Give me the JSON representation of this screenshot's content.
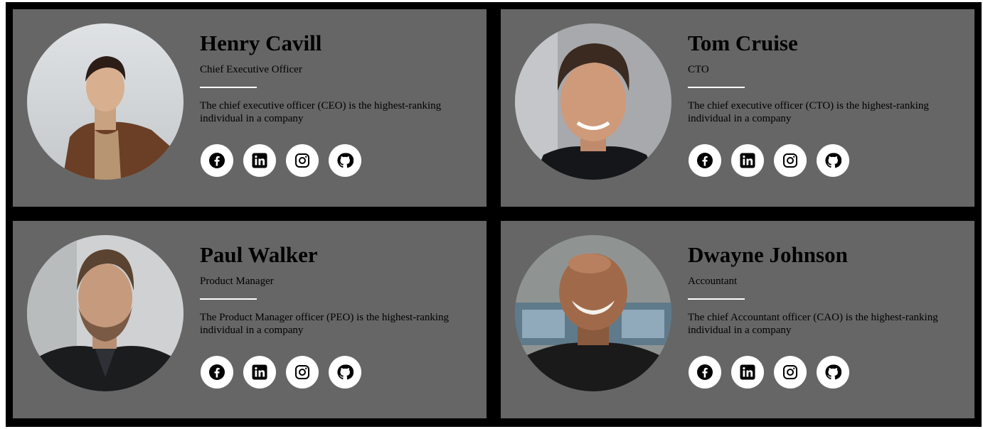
{
  "team": [
    {
      "name": "Henry Cavill",
      "role": "Chief Executive Officer",
      "description": "The chief executive officer (CEO) is the highest-ranking individual in a company",
      "photo": "portrait-photo-henry-cavill"
    },
    {
      "name": "Tom Cruise",
      "role": "CTO",
      "description": "The chief executive officer (CTO) is the highest-ranking individual in a company",
      "photo": "portrait-photo-tom-cruise"
    },
    {
      "name": "Paul Walker",
      "role": "Product Manager",
      "description": "The Product Manager officer (PEO) is the highest-ranking individual in a company",
      "photo": "portrait-photo-paul-walker"
    },
    {
      "name": "Dwayne Johnson",
      "role": "Accountant",
      "description": "The chief Accountant officer (CAO) is the highest-ranking individual in a company",
      "photo": "portrait-photo-dwayne-johnson"
    }
  ],
  "social_icons": [
    "facebook-icon",
    "linkedin-icon",
    "instagram-icon",
    "github-icon"
  ],
  "colors": {
    "page_background": "#000000",
    "card_background": "#666666",
    "text": "#000000",
    "divider": "#ffffff",
    "icon_background": "#ffffff",
    "icon_glyph": "#000000"
  }
}
